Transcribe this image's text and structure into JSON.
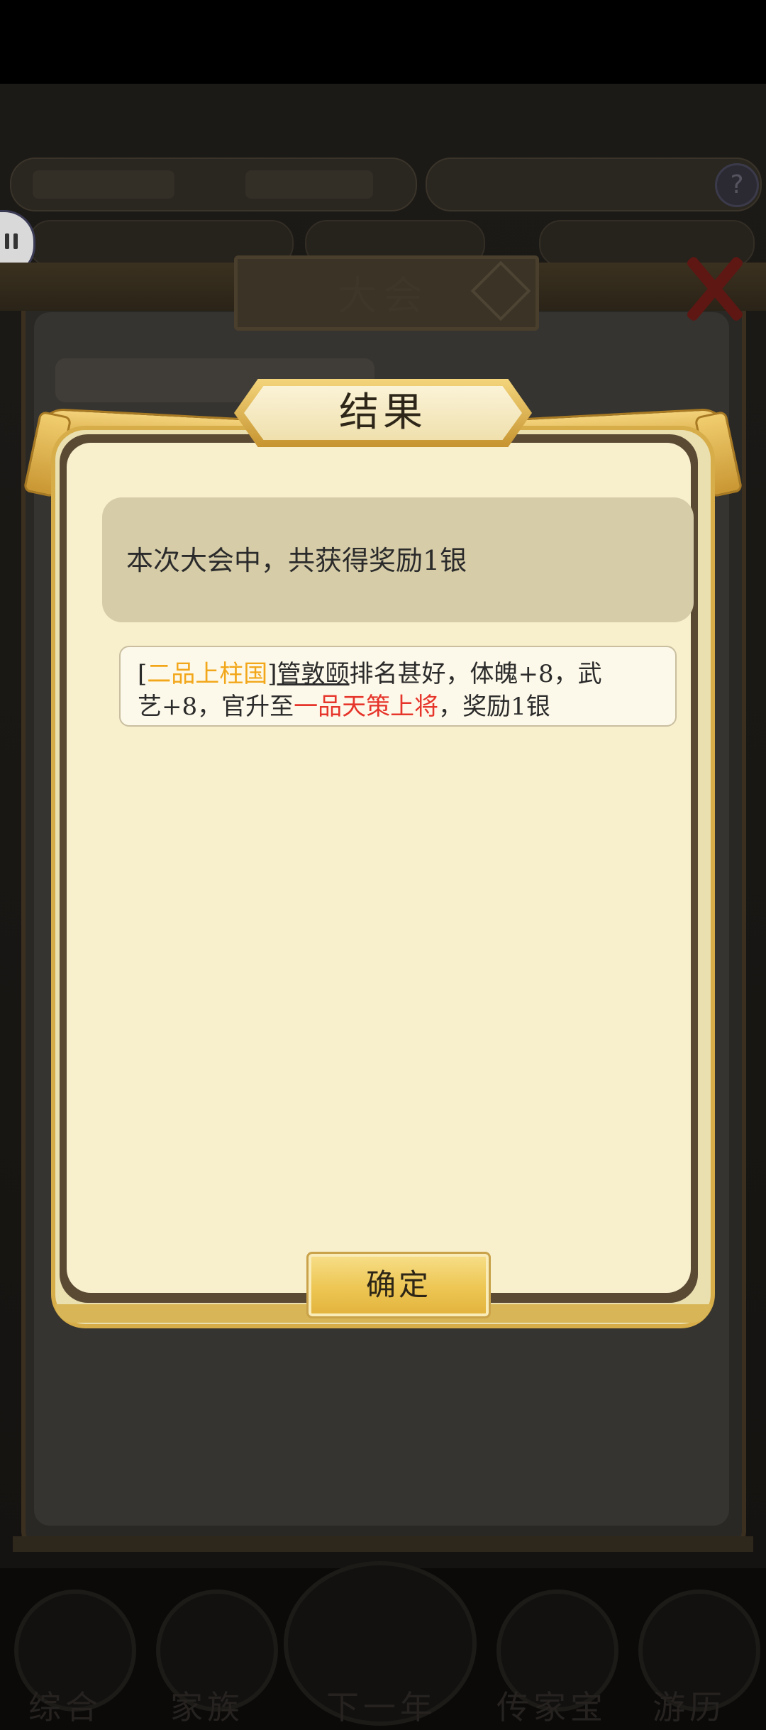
{
  "background": {
    "panel_title": "大会",
    "bottom_nav": [
      "综合",
      "家族",
      "下一年",
      "传家宝",
      "游历"
    ]
  },
  "modal": {
    "title": "结果",
    "summary": "本次大会中，共获得奖励1银",
    "detail": {
      "open_bracket": "[",
      "rank_from": "二品上柱国",
      "close_bracket": "]",
      "person": "管敦颐",
      "text1": "排名甚好，体魄+8，武",
      "text2": "艺+8，官升至",
      "rank_to": "一品天策上将",
      "text3": "，奖励1银"
    },
    "confirm_label": "确定"
  },
  "colors": {
    "rank_from": "#f2a71b",
    "rank_to": "#e6352b",
    "modal_bg": "#f8efcd",
    "gold": "#d6ad49"
  }
}
